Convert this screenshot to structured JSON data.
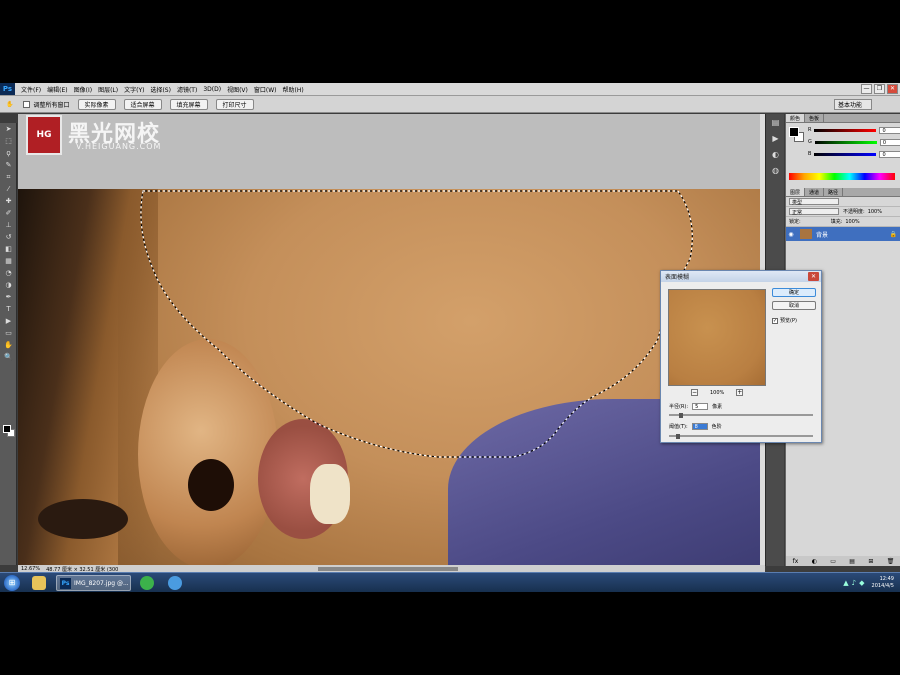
{
  "menubar": {
    "app_logo": "Ps",
    "items": [
      "文件(F)",
      "编辑(E)",
      "图像(I)",
      "图层(L)",
      "文字(Y)",
      "选择(S)",
      "滤镜(T)",
      "3D(D)",
      "视图(V)",
      "窗口(W)",
      "帮助(H)"
    ],
    "win_buttons": [
      "—",
      "❐",
      "✕"
    ]
  },
  "optionsbar": {
    "check_label": "调整所有窗口",
    "buttons": [
      "实际像素",
      "适合屏幕",
      "填充屏幕",
      "打印尺寸"
    ],
    "workspace": "基本功能"
  },
  "canvas": {
    "watermark": {
      "badge": "HG",
      "text": "黑光网校",
      "url": "V.HEIGUANG.COM"
    }
  },
  "statusbar": {
    "zoom": "12.67%",
    "doc_info": "48.77 厘米 × 32.51 厘米 (300"
  },
  "color_panel": {
    "tabs": [
      "颜色",
      "色板"
    ],
    "channels": [
      {
        "label": "R",
        "value": "0"
      },
      {
        "label": "G",
        "value": "0"
      },
      {
        "label": "B",
        "value": "0"
      }
    ]
  },
  "layers_panel": {
    "tabs": [
      "图层",
      "通道",
      "路径"
    ],
    "kind": "类型",
    "blend_mode": "正常",
    "opacity_label": "不透明度:",
    "opacity_value": "100%",
    "lock_label": "锁定:",
    "fill_label": "填充:",
    "fill_value": "100%",
    "layers": [
      {
        "name": "背景"
      }
    ],
    "footer_icons": [
      "fx",
      "◐",
      "▭",
      "▤",
      "⊞",
      "🗑"
    ]
  },
  "dialog": {
    "title": "表面模糊",
    "ok": "确定",
    "cancel": "取消",
    "preview_label": "预览(P)",
    "zoom": "100%",
    "radius_label": "半径(R):",
    "radius_value": "5",
    "radius_unit": "像素",
    "threshold_label": "阈值(T):",
    "threshold_value": "8",
    "threshold_unit": "色阶"
  },
  "taskbar": {
    "ps_label": "IMG_8207.jpg @...",
    "clock_time": "12:49",
    "clock_date": "2014/4/5"
  }
}
